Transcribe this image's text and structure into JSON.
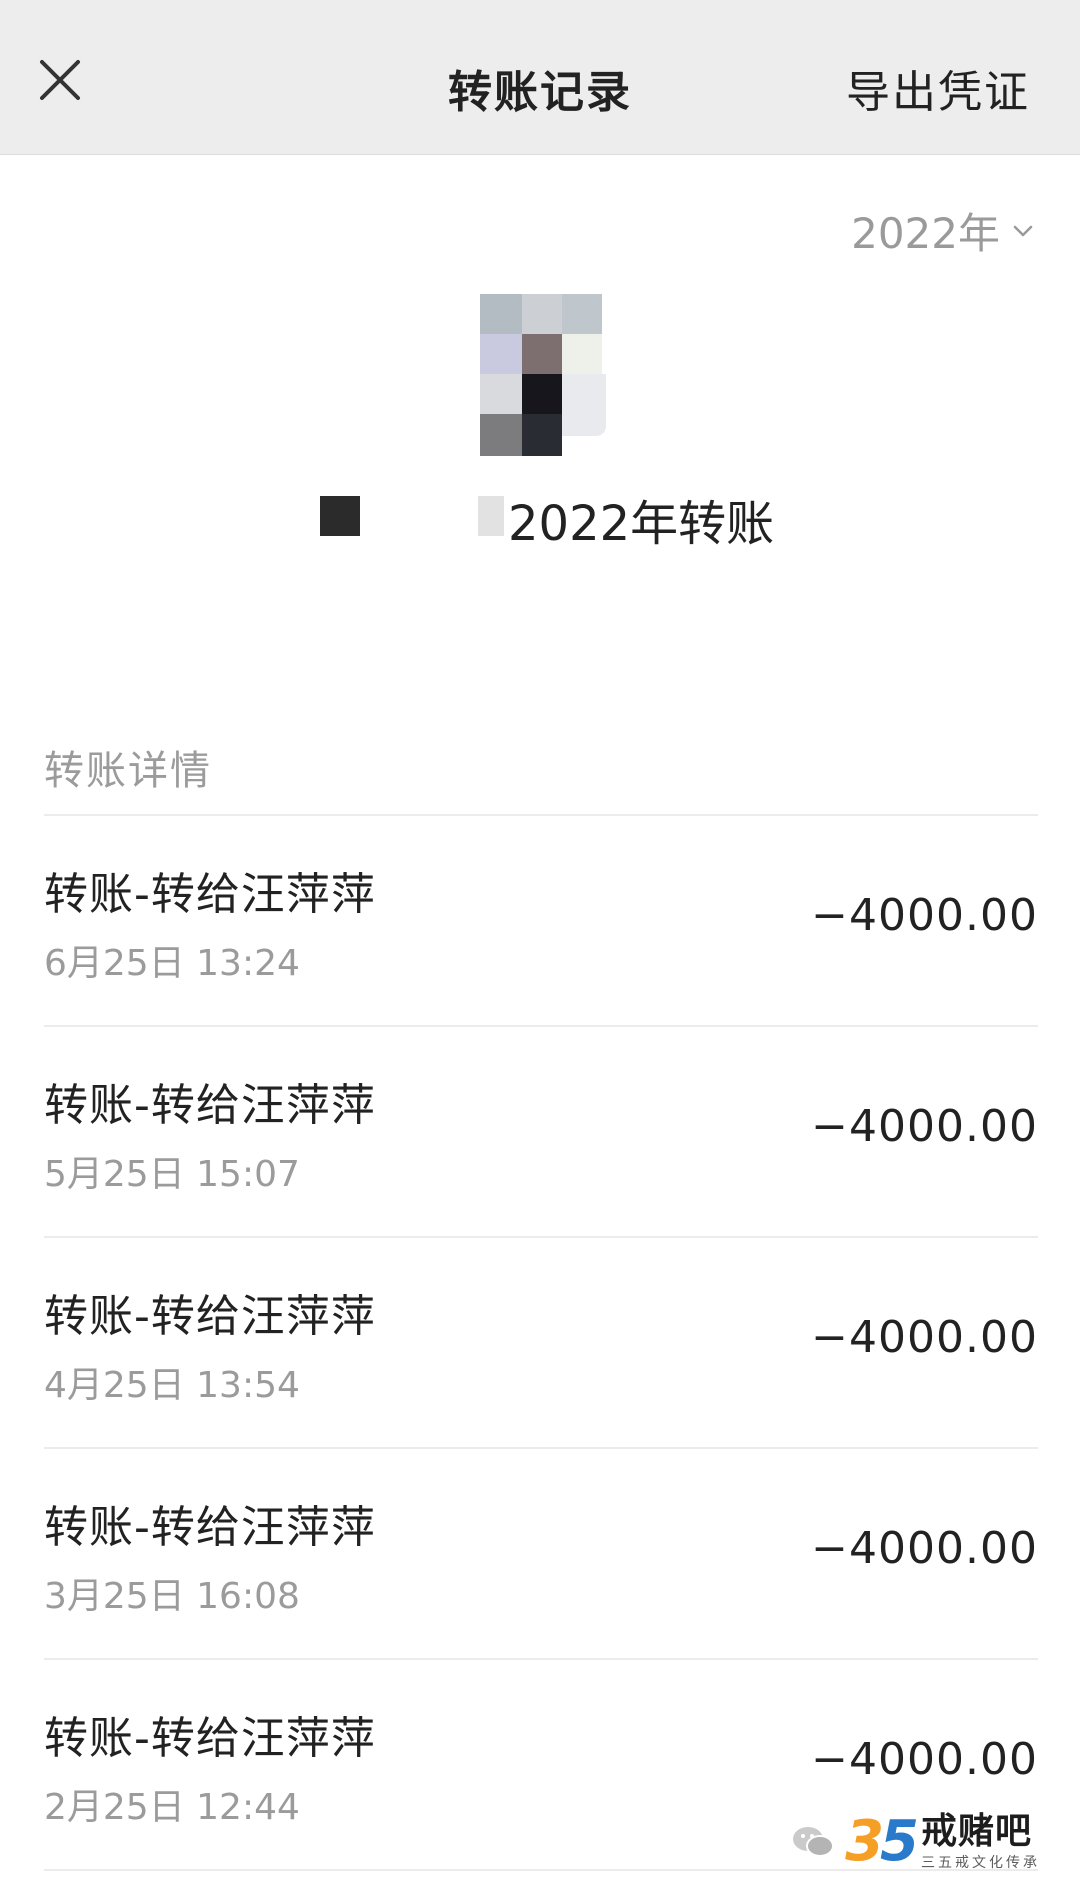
{
  "header": {
    "title": "转账记录",
    "export_label": "导出凭证"
  },
  "filter": {
    "year_label": "2022年"
  },
  "summary": {
    "text": "2022年转账"
  },
  "section": {
    "header": "转账详情"
  },
  "transactions": [
    {
      "title": "转账-转给汪萍萍",
      "time": "6月25日 13:24",
      "amount": "−4000.00"
    },
    {
      "title": "转账-转给汪萍萍",
      "time": "5月25日 15:07",
      "amount": "−4000.00"
    },
    {
      "title": "转账-转给汪萍萍",
      "time": "4月25日 13:54",
      "amount": "−4000.00"
    },
    {
      "title": "转账-转给汪萍萍",
      "time": "3月25日 16:08",
      "amount": "−4000.00"
    },
    {
      "title": "转账-转给汪萍萍",
      "time": "2月25日 12:44",
      "amount": "−4000.00"
    }
  ],
  "watermark": {
    "number_a": "3",
    "number_b": "5",
    "brand": "戒赌吧",
    "slogan": "三五戒文化传承"
  },
  "icons": {
    "close": "close-icon",
    "chevron": "chevron-down-icon",
    "wechat": "wechat-icon"
  }
}
